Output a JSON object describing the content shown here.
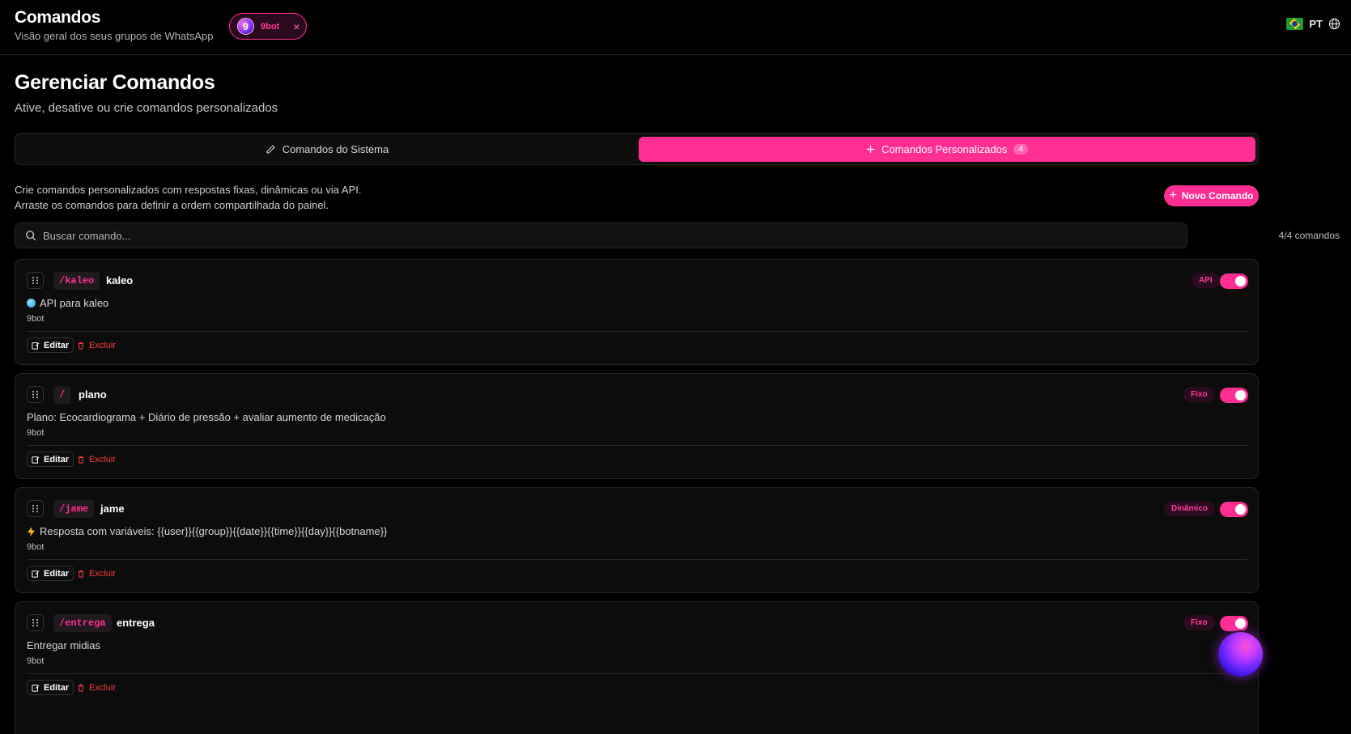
{
  "header": {
    "title": "Comandos",
    "subtitle": "Visão geral dos seus grupos de WhatsApp",
    "bot_chip": {
      "avatar_text": "9",
      "label": "9bot",
      "close": "×"
    },
    "language": {
      "flag": "brazil-flag",
      "code": "PT"
    }
  },
  "page": {
    "title": "Gerenciar Comandos",
    "subtitle": "Ative, desative ou crie comandos personalizados"
  },
  "tabs": [
    {
      "label": "Comandos do Sistema",
      "icon": "pencil-icon",
      "active": false
    },
    {
      "label": "Comandos Personalizados",
      "icon": "plus-icon",
      "active": true,
      "count": "4"
    }
  ],
  "description": {
    "line1": "Crie comandos personalizados com respostas fixas, dinâmicas ou via API.",
    "line2": "Arraste os comandos para definir a ordem compartilhada do painel."
  },
  "new_button": {
    "label": "Novo Comando"
  },
  "search": {
    "placeholder": "Buscar comando...",
    "value": ""
  },
  "count_label": "4/4 comandos",
  "actions": {
    "edit": "Editar",
    "delete": "Excluir"
  },
  "commands": [
    {
      "trigger": "/kaleo",
      "name": "kaleo",
      "type": "API",
      "enabled": true,
      "response_icon": "globe-emoji",
      "response": "API para kaleo",
      "owner": "9bot"
    },
    {
      "trigger": "/",
      "name": "plano",
      "type": "Fixo",
      "enabled": true,
      "response_icon": "",
      "response": "Plano: Ecocardiograma + Diário de pressão + avaliar aumento de medicação",
      "owner": "9bot"
    },
    {
      "trigger": "/jame",
      "name": "jame",
      "type": "Dinâmico",
      "enabled": true,
      "response_icon": "lightning-emoji",
      "response": "Resposta com variáveis: {{user}}{{group}}{{date}}{{time}}{{day}}{{botname}}",
      "owner": "9bot"
    },
    {
      "trigger": "/entrega",
      "name": "entrega",
      "type": "Fixo",
      "enabled": true,
      "response_icon": "",
      "response": "Entregar midias",
      "owner": "9bot"
    }
  ],
  "colors": {
    "accent": "#ff2e93",
    "danger": "#ff3b3b",
    "background": "#000000",
    "card": "#0c0c0c",
    "border": "#262626"
  }
}
